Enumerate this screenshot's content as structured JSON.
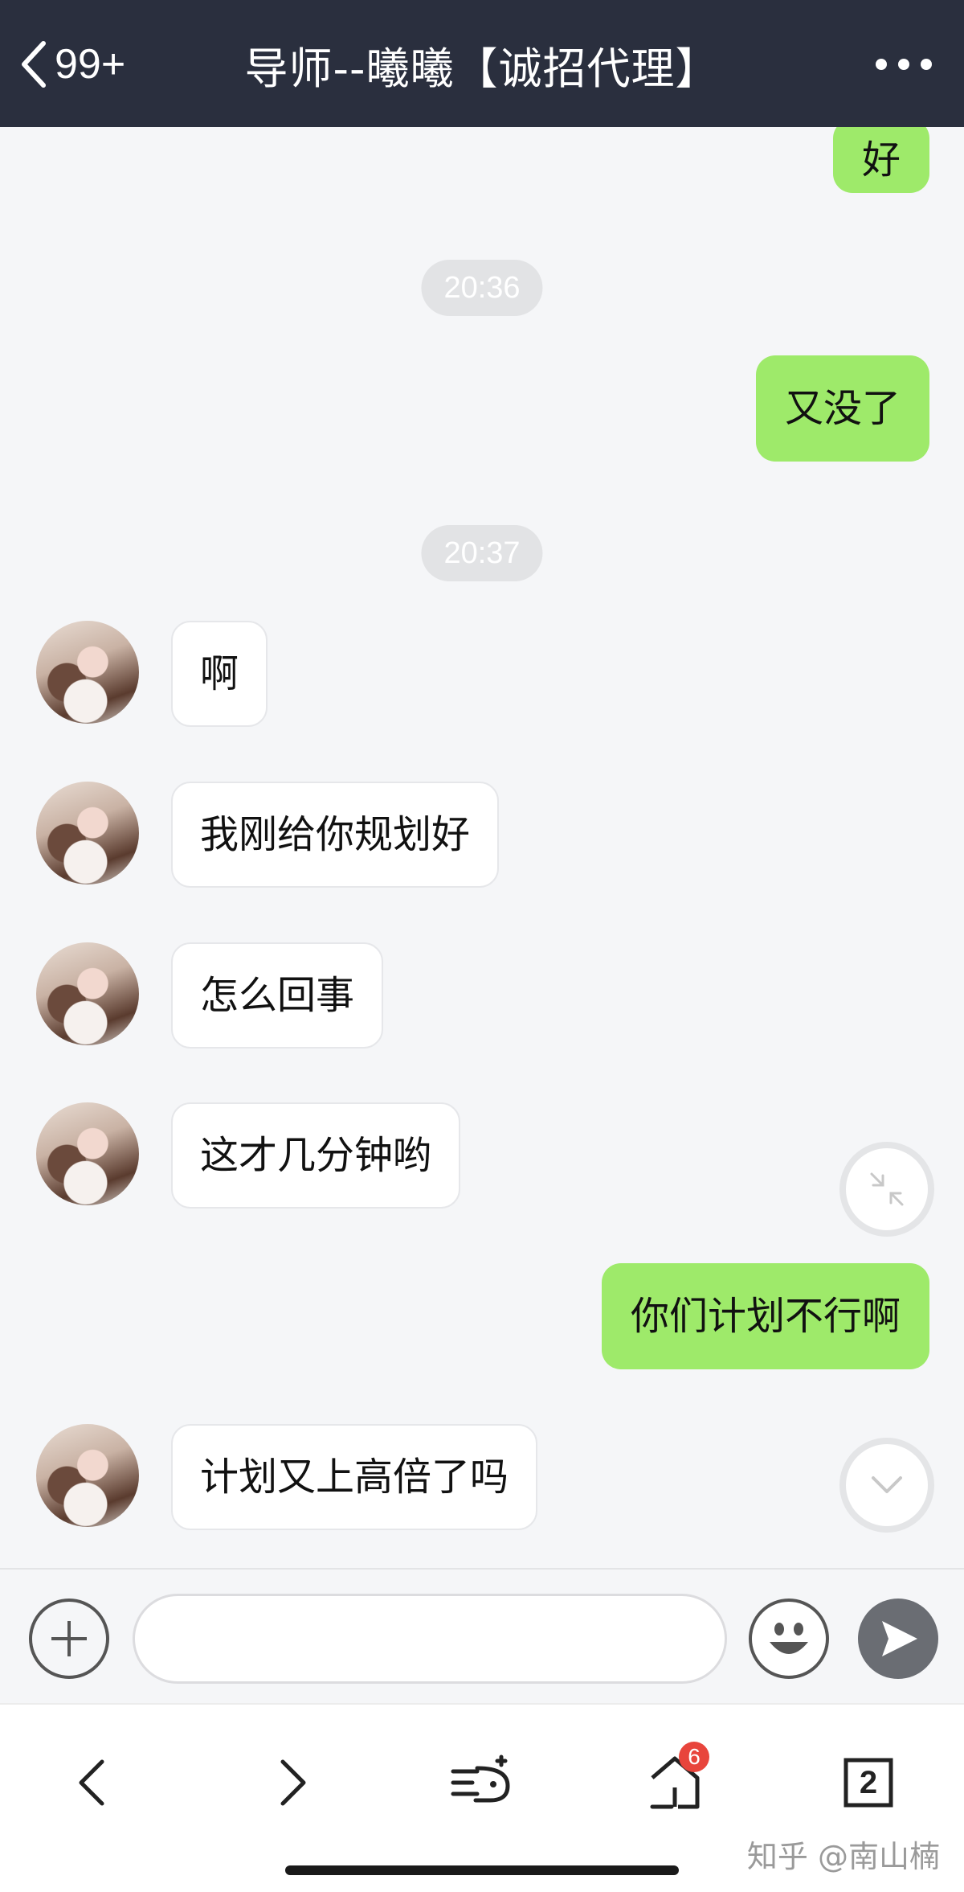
{
  "header": {
    "back_count": "99+",
    "title": "导师--曦曦【诚招代理】"
  },
  "messages": {
    "m0": "好",
    "t1": "20:36",
    "m1": "又没了",
    "t2": "20:37",
    "m2": "啊",
    "m3": "我刚给你规划好",
    "m4": "怎么回事",
    "m5": "这才几分钟哟",
    "m6": "你们计划不行啊",
    "m7": "计划又上高倍了吗"
  },
  "input": {
    "value": "",
    "placeholder": ""
  },
  "browser": {
    "notification_badge": "6",
    "tabs_count": "2",
    "watermark": "知乎 @南山楠"
  },
  "colors": {
    "header_bg": "#2a2f3e",
    "outgoing_bubble": "#9eea6a",
    "incoming_bubble": "#ffffff",
    "chat_bg": "#f5f6f8",
    "badge": "#e8453c"
  },
  "icons": [
    "back-icon",
    "more-icon",
    "collapse-icon",
    "scroll-down-icon",
    "plus-icon",
    "emoji-icon",
    "send-icon",
    "nav-back-icon",
    "nav-forward-icon",
    "feed-icon",
    "home-icon",
    "tabs-icon"
  ]
}
